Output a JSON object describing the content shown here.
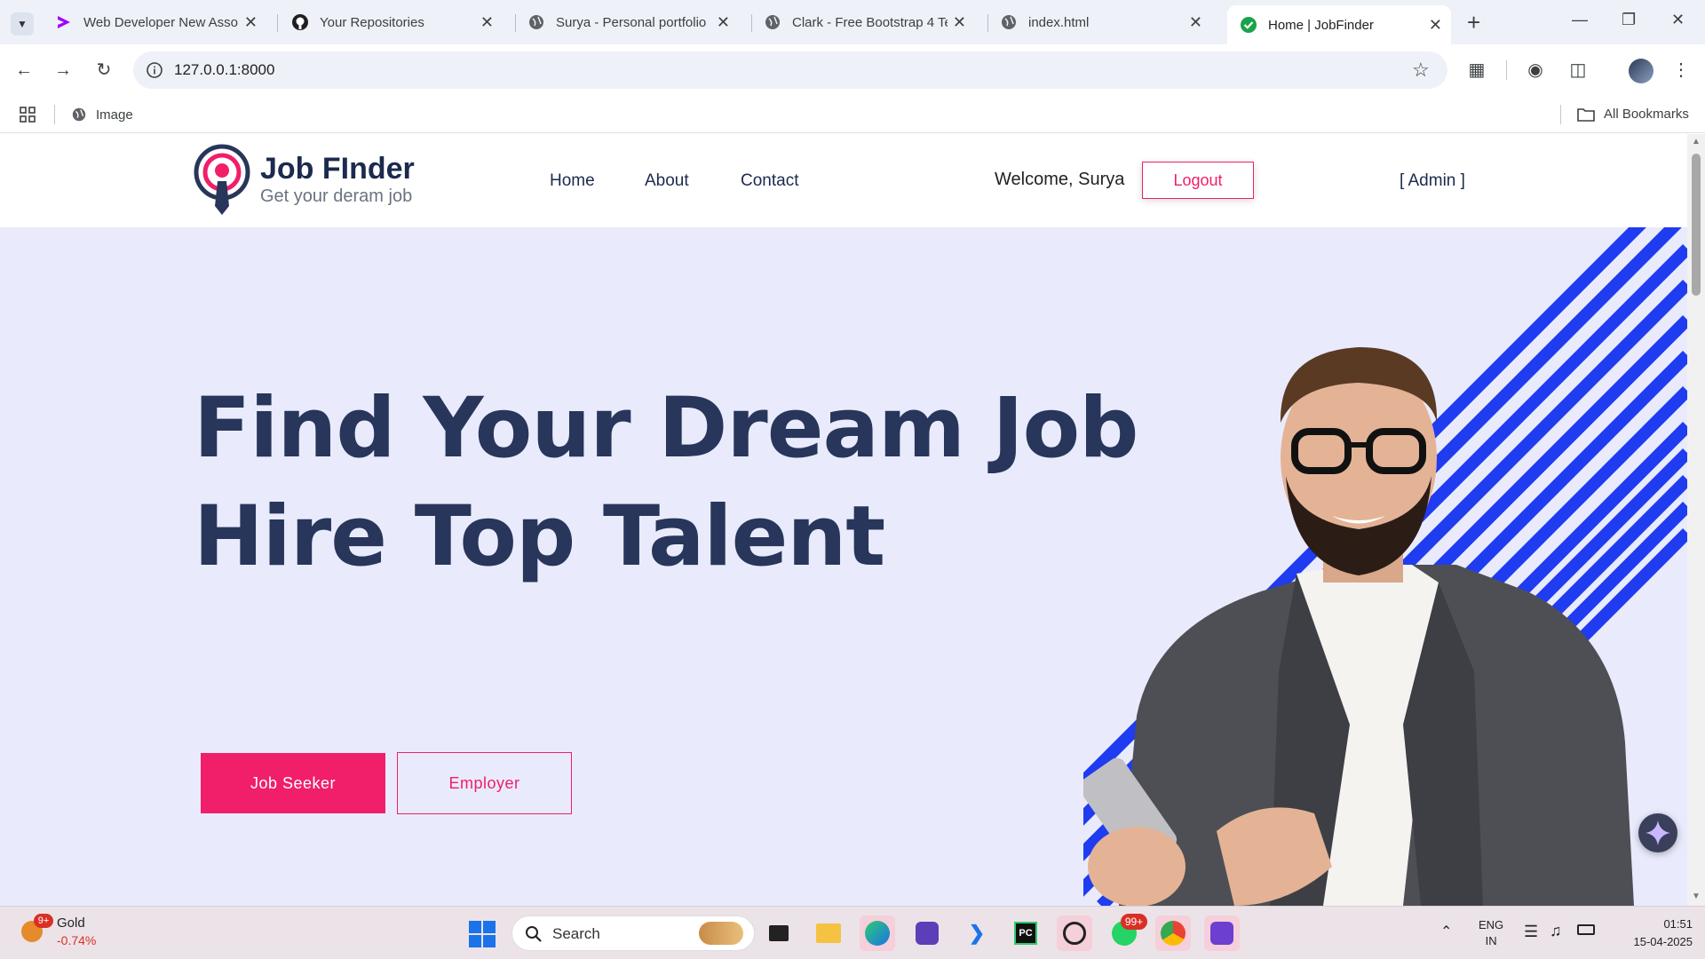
{
  "browser": {
    "tabs": [
      {
        "title": "Web Developer New Asso",
        "active": false
      },
      {
        "title": "Your Repositories",
        "active": false
      },
      {
        "title": "Surya - Personal portfolio",
        "active": false
      },
      {
        "title": "Clark - Free Bootstrap 4 Te",
        "active": false
      },
      {
        "title": "index.html",
        "active": false
      },
      {
        "title": "Home | JobFinder",
        "active": true
      }
    ],
    "url": "127.0.0.1:8000",
    "bookmarks": {
      "image": "Image",
      "all": "All Bookmarks"
    }
  },
  "site": {
    "logo_title": "Job FInder",
    "logo_tagline": "Get your deram job",
    "nav": {
      "home": "Home",
      "about": "About",
      "contact": "Contact"
    },
    "welcome": "Welcome, Surya",
    "logout": "Logout",
    "admin": "[ Admin ]"
  },
  "hero": {
    "line1": "Find Your Dream Job",
    "line2": "Hire Top Talent",
    "btn_seeker": "Job Seeker",
    "btn_employer": "Employer"
  },
  "taskbar": {
    "widget_badge": "9+",
    "widget_title": "Gold",
    "widget_change": "-0.74%",
    "search": "Search",
    "whatsapp_badge": "99+",
    "lang1": "ENG",
    "lang2": "IN",
    "time": "01:51",
    "date": "15-04-2025"
  },
  "colors": {
    "accent": "#f11e6a",
    "navy": "#27365a",
    "hero_bg": "#e9ebfc",
    "stripes": "#1f3cf0"
  }
}
